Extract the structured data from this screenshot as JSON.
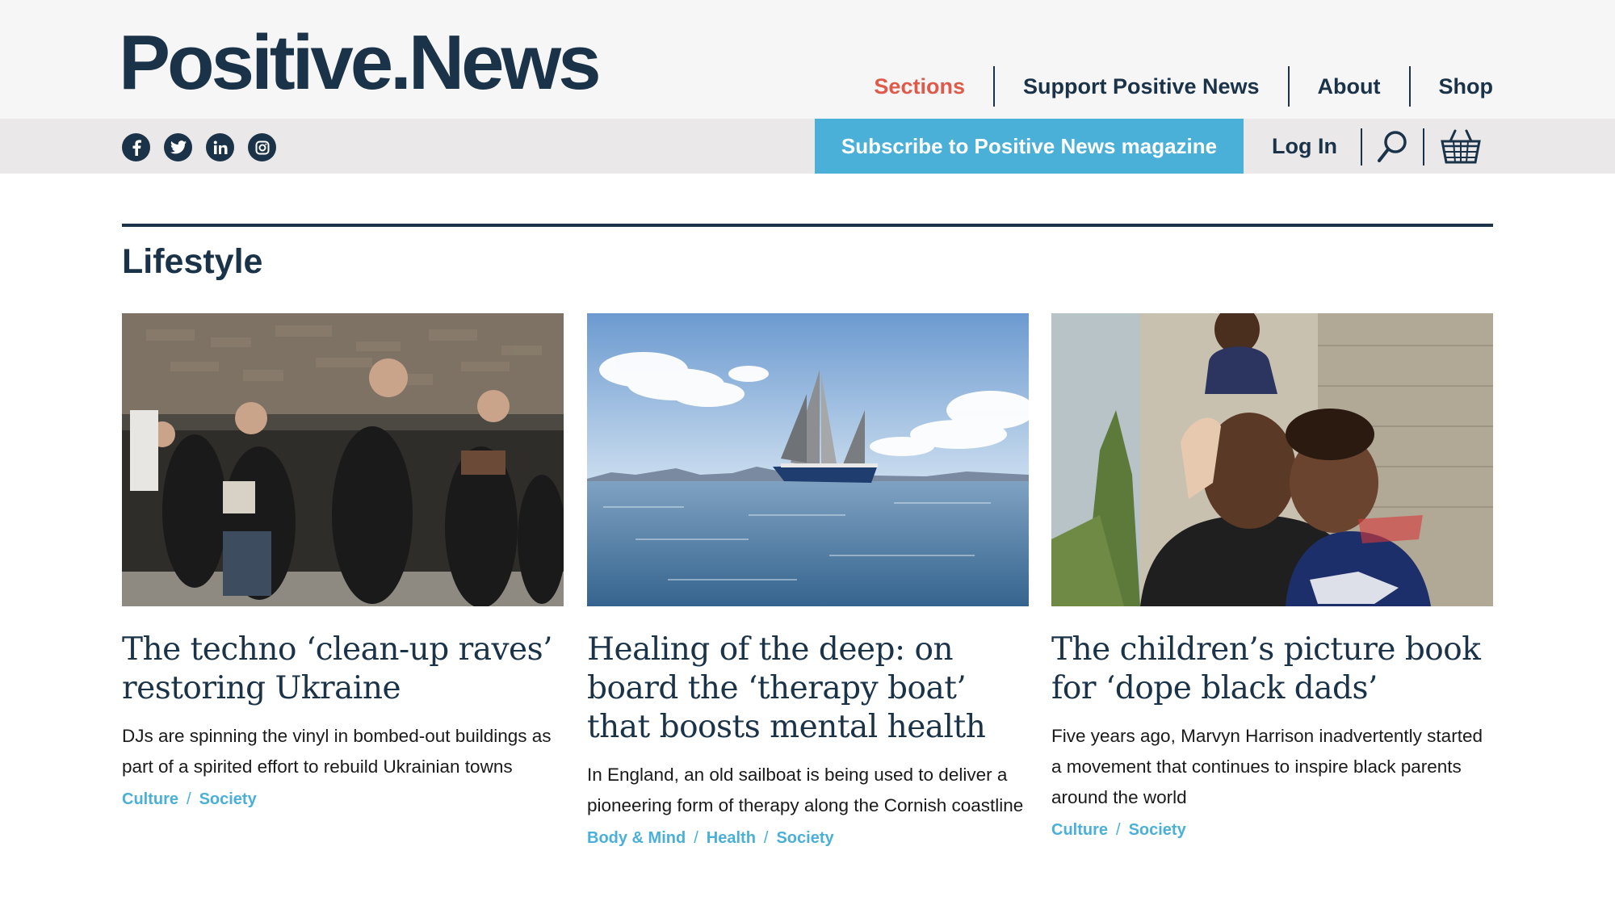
{
  "site": {
    "logo": "Positive.News"
  },
  "main_nav": [
    {
      "label": "Sections",
      "active": true
    },
    {
      "label": "Support Positive News",
      "active": false
    },
    {
      "label": "About",
      "active": false
    },
    {
      "label": "Shop",
      "active": false
    }
  ],
  "social_icons": [
    "facebook-icon",
    "twitter-icon",
    "linkedin-icon",
    "instagram-icon"
  ],
  "subscribe_label": "Subscribe to Positive News magazine",
  "login_label": "Log In",
  "section_title": "Lifestyle",
  "colors": {
    "navy": "#1b3348",
    "accent_red": "#e05a4a",
    "accent_blue": "#4bb0d7",
    "top_band": "#f6f6f7",
    "sub_band": "#ebe8ea"
  },
  "articles": [
    {
      "image": "ravers-in-ruined-building",
      "title": "The techno ‘clean-up raves’ restoring Ukraine",
      "summary": "DJs are spinning the vinyl in bombed-out buildings as part of a spirited effort to rebuild Ukrainian towns",
      "tags": [
        "Culture",
        "Society"
      ]
    },
    {
      "image": "sailboat-at-sea",
      "title": "Healing of the deep: on board the ‘therapy boat’ that boosts mental health",
      "summary": "In England, an old sailboat is being used to deliver a pioneering form of therapy along the Cornish coastline",
      "tags": [
        "Body & Mind",
        "Health",
        "Society"
      ]
    },
    {
      "image": "father-and-children",
      "title": "The children’s picture book for ‘dope black dads’",
      "summary": "Five years ago, Marvyn Harrison inadvertently started a movement that continues to inspire black parents around the world",
      "tags": [
        "Culture",
        "Society"
      ]
    }
  ]
}
